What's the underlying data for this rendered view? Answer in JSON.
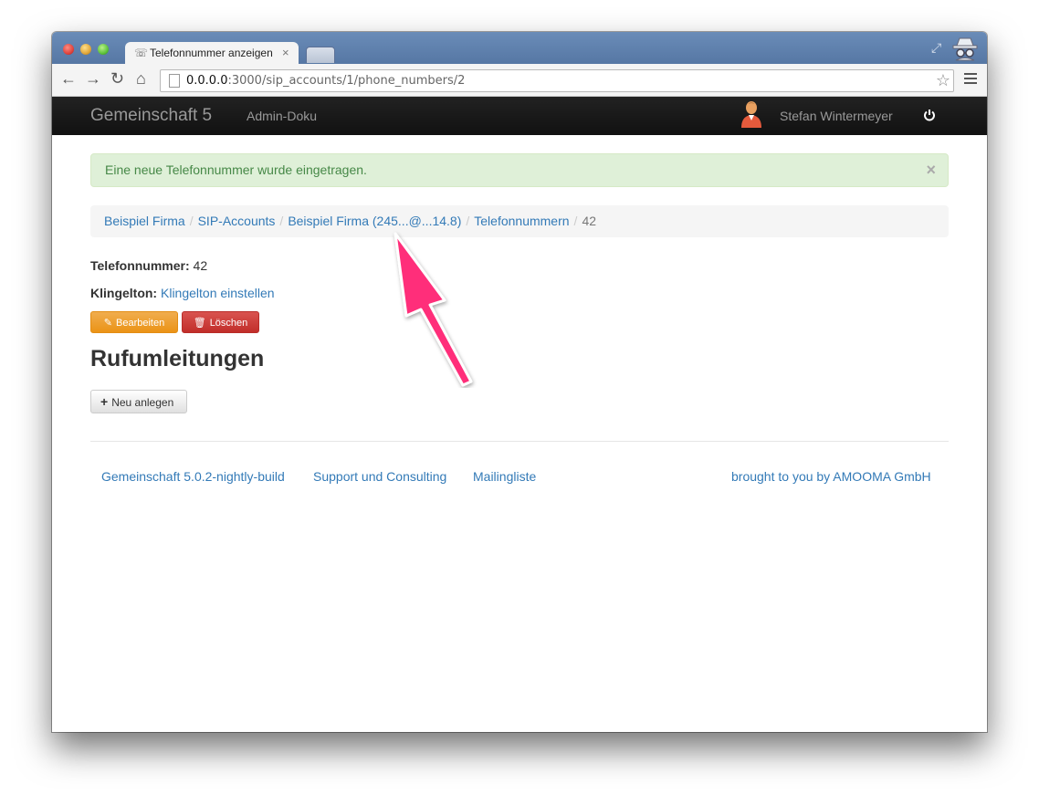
{
  "browser": {
    "tab_title": "Telefonnummer anzeigen",
    "tab_close": "×",
    "url_host": "0.0.0.0",
    "url_path": ":3000/sip_accounts/1/phone_numbers/2"
  },
  "navbar": {
    "brand": "Gemeinschaft 5",
    "link": "Admin-Doku",
    "user": "Stefan Wintermeyer"
  },
  "alert": {
    "message": "Eine neue Telefonnummer wurde eingetragen.",
    "close": "×"
  },
  "breadcrumb": {
    "items": [
      "Beispiel Firma",
      "SIP-Accounts",
      "Beispiel Firma (245...@...14.8)",
      "Telefonnummern"
    ],
    "active": "42",
    "separator": "/"
  },
  "details": {
    "number_label": "Telefonnummer:",
    "number_value": "42",
    "ringtone_label": "Klingelton:",
    "ringtone_link": "Klingelton einstellen"
  },
  "actions": {
    "edit": "Bearbeiten",
    "delete": "Löschen"
  },
  "forwarding": {
    "heading": "Rufumleitungen",
    "new_button": "Neu anlegen"
  },
  "footer": {
    "version": "Gemeinschaft 5.0.2-nightly-build",
    "support": "Support und Consulting",
    "mailinglist": "Mailingliste",
    "credit": "brought to you by AMOOMA GmbH"
  },
  "colors": {
    "link": "#337ab7",
    "alert_bg": "#dff0d8",
    "warning": "#f0ad4e",
    "danger": "#d9534f",
    "annotation_arrow": "#ff2f7a"
  },
  "icons": [
    "back-icon",
    "forward-icon",
    "reload-icon",
    "home-icon",
    "star-icon",
    "menu-icon",
    "avatar-icon",
    "power-icon",
    "edit-icon",
    "trash-icon",
    "plus-icon",
    "incognito-icon"
  ]
}
